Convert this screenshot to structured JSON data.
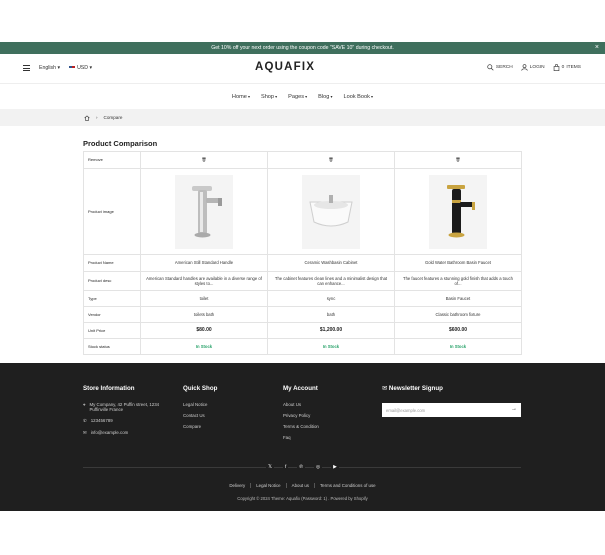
{
  "announcement": "Get 10% off your next order using the coupon code \"SAVE 10\" during checkout.",
  "header": {
    "language": "English",
    "currency": "USD",
    "logo": "AQUAFIX",
    "search": "SERCH",
    "login": "LOGIN",
    "cart_count": "0",
    "cart_label": "ITEMS"
  },
  "nav": [
    "Home",
    "Shop",
    "Pages",
    "Blog",
    "Look Book"
  ],
  "breadcrumb": {
    "current": "Compare"
  },
  "page_title": "Product Comparison",
  "table": {
    "labels": {
      "remove": "Remove",
      "image": "Product image",
      "name": "Product Name",
      "desc": "Product desc",
      "type": "Type",
      "vendor": "Vendor",
      "price": "Unit Price",
      "stock": "Stock status"
    },
    "products": [
      {
        "name": "American Still Standard Handle",
        "desc": "American Standard handles are available in a diverse range of styles to...",
        "type": "toilet",
        "vendor": "toilets bath",
        "price": "$80.00",
        "stock": "In Stock",
        "image": "faucet-chrome"
      },
      {
        "name": "Ceramic Washbasin Cabinet",
        "desc": "The cabinet features clean lines and a minimalist design that can enhance...",
        "type": "sync",
        "vendor": "bath",
        "price": "$1,200.00",
        "stock": "In Stock",
        "image": "washbasin"
      },
      {
        "name": "Gold Water Bathroom Basin Faucet",
        "desc": "The faucet features a stunning gold finish that adds a touch of...",
        "type": "Basin Faucet",
        "vendor": "Classic bathroom fixture",
        "price": "$600.00",
        "stock": "In Stock",
        "image": "faucet-gold-black"
      }
    ]
  },
  "footer": {
    "store": {
      "title": "Store Information",
      "address": "My Company, 42 Puffin street, 1234 Puffinville France",
      "phone": "123456789",
      "email": "info@example.com"
    },
    "quick": {
      "title": "Quick Shop",
      "links": [
        "Legal Notice",
        "Contact Us",
        "Compare"
      ]
    },
    "account": {
      "title": "My Account",
      "links": [
        "About Us",
        "Privacy Policy",
        "Terms & Condition",
        "Faq"
      ]
    },
    "newsletter": {
      "title": "Newsletter Signup",
      "placeholder": "email@example.com"
    },
    "social": [
      "x-icon",
      "facebook-icon",
      "pinterest-icon",
      "instagram-icon",
      "youtube-icon"
    ],
    "bottom_links": [
      "Delivery",
      "Legal Notice",
      "About us",
      "Terms and Conditions of use"
    ],
    "copyright": "Copyright © 2024 Theme: Aquafix (Password: 1) . Powered by Shopify"
  },
  "colors": {
    "announce_bg": "#3f6f5d",
    "footer_bg": "#1f1f1f",
    "stock": "#2aa36b"
  }
}
